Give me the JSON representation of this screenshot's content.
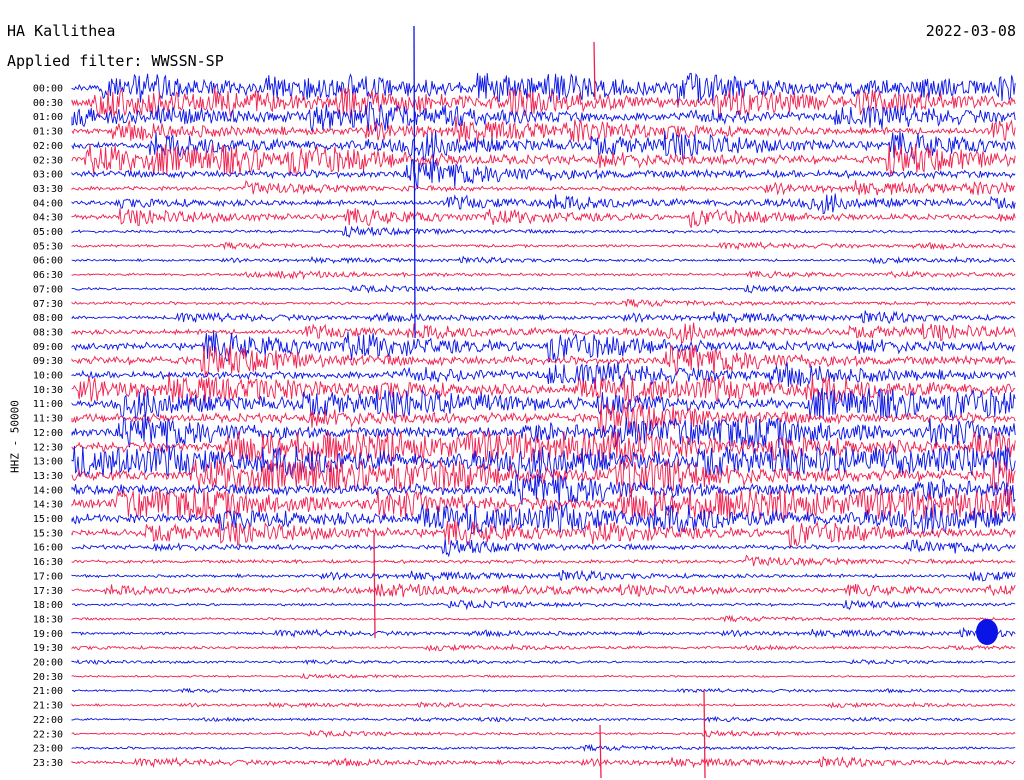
{
  "header": {
    "station": "HA Kallithea",
    "date": "2022-03-08",
    "filter": "Applied filter: WWSSN-SP",
    "channel": "HHZ - 50000"
  },
  "colors": {
    "odd": "#0a14e6",
    "even": "#f0204e",
    "text": "#000000"
  },
  "chart_data": {
    "type": "line",
    "title": "HA Kallithea",
    "subtitle": "Applied filter: WWSSN-SP",
    "ylabel": "HHZ - 50000",
    "rows": [
      "00:00",
      "00:30",
      "01:00",
      "01:30",
      "02:00",
      "02:30",
      "03:00",
      "03:30",
      "04:00",
      "04:30",
      "05:00",
      "05:30",
      "06:00",
      "06:30",
      "07:00",
      "07:30",
      "08:00",
      "08:30",
      "09:00",
      "09:30",
      "10:00",
      "10:30",
      "11:00",
      "11:30",
      "12:00",
      "12:30",
      "13:00",
      "13:30",
      "14:00",
      "14:30",
      "15:00",
      "15:30",
      "16:00",
      "16:30",
      "17:00",
      "17:30",
      "18:00",
      "18:30",
      "19:00",
      "19:30",
      "20:00",
      "20:30",
      "21:00",
      "21:30",
      "22:00",
      "22:30",
      "23:00",
      "23:30"
    ],
    "row_activity": [
      0.55,
      0.6,
      0.5,
      0.45,
      0.5,
      0.6,
      0.55,
      0.25,
      0.3,
      0.3,
      0.15,
      0.12,
      0.08,
      0.1,
      0.1,
      0.15,
      0.18,
      0.3,
      0.55,
      0.6,
      0.55,
      0.6,
      0.65,
      0.7,
      0.75,
      0.8,
      0.85,
      0.85,
      0.85,
      0.8,
      0.7,
      0.45,
      0.25,
      0.2,
      0.15,
      0.2,
      0.12,
      0.1,
      0.12,
      0.08,
      0.05,
      0.05,
      0.06,
      0.06,
      0.06,
      0.08,
      0.1,
      0.15
    ]
  }
}
